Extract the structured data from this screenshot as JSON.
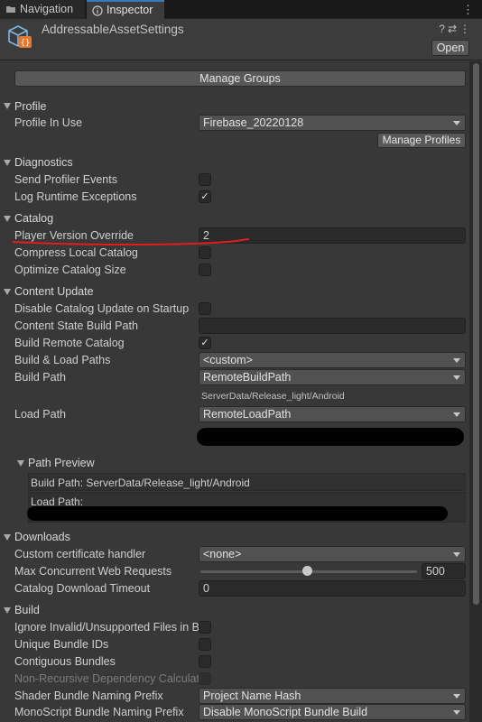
{
  "tabs": [
    {
      "label": "Navigation",
      "icon": "folder-icon"
    },
    {
      "label": "Inspector",
      "icon": "info-icon"
    }
  ],
  "header": {
    "title": "AddressableAssetSettings",
    "open_label": "Open",
    "icons": [
      "help-icon",
      "preset-icon",
      "kebab-icon"
    ]
  },
  "manage_groups_label": "Manage Groups",
  "profile": {
    "section": "Profile",
    "profile_in_use_label": "Profile In Use",
    "profile_in_use_value": "Firebase_20220128",
    "manage_profiles_label": "Manage Profiles"
  },
  "diagnostics": {
    "section": "Diagnostics",
    "send_profiler_events": {
      "label": "Send Profiler Events",
      "checked": false
    },
    "log_runtime_exceptions": {
      "label": "Log Runtime Exceptions",
      "checked": true
    }
  },
  "catalog": {
    "section": "Catalog",
    "player_version_override": {
      "label": "Player Version Override",
      "value": "2"
    },
    "compress_local_catalog": {
      "label": "Compress Local Catalog",
      "checked": false
    },
    "optimize_catalog_size": {
      "label": "Optimize Catalog Size",
      "checked": false
    }
  },
  "content_update": {
    "section": "Content Update",
    "disable_catalog_update": {
      "label": "Disable Catalog Update on Startup",
      "checked": false
    },
    "content_state_build_path": {
      "label": "Content State Build Path",
      "value": ""
    },
    "build_remote_catalog": {
      "label": "Build Remote Catalog",
      "checked": true
    },
    "build_load_paths": {
      "label": "Build & Load Paths",
      "value": "<custom>"
    },
    "build_path": {
      "label": "Build Path",
      "value": "RemoteBuildPath",
      "resolved": "ServerData/Release_light/Android"
    },
    "load_path": {
      "label": "Load Path",
      "value": "RemoteLoadPath"
    },
    "path_preview": {
      "section": "Path Preview",
      "build_path": "Build Path: ServerData/Release_light/Android",
      "load_path": "Load Path:"
    }
  },
  "downloads": {
    "section": "Downloads",
    "custom_cert": {
      "label": "Custom certificate handler",
      "value": "<none>"
    },
    "max_concurrent": {
      "label": "Max Concurrent Web Requests",
      "value": "500",
      "slider_fraction": 0.5
    },
    "timeout": {
      "label": "Catalog Download Timeout",
      "value": "0"
    }
  },
  "build": {
    "section": "Build",
    "ignore_invalid": {
      "label": "Ignore Invalid/Unsupported Files in Bui",
      "checked": false
    },
    "unique_bundle_ids": {
      "label": "Unique Bundle IDs",
      "checked": false
    },
    "contiguous_bundles": {
      "label": "Contiguous Bundles",
      "checked": false
    },
    "non_recursive": {
      "label": "Non-Recursive Dependency Calculatio",
      "checked": false
    },
    "shader_prefix": {
      "label": "Shader Bundle Naming Prefix",
      "value": "Project Name Hash"
    },
    "monoscript_prefix": {
      "label": "MonoScript Bundle Naming Prefix",
      "value": "Disable MonoScript Bundle Build"
    }
  },
  "colors": {
    "background": "#383838",
    "field": "#2a2a2a",
    "button": "#585858",
    "accent_tab": "#3a79bb",
    "annotation": "#e01e1e"
  }
}
